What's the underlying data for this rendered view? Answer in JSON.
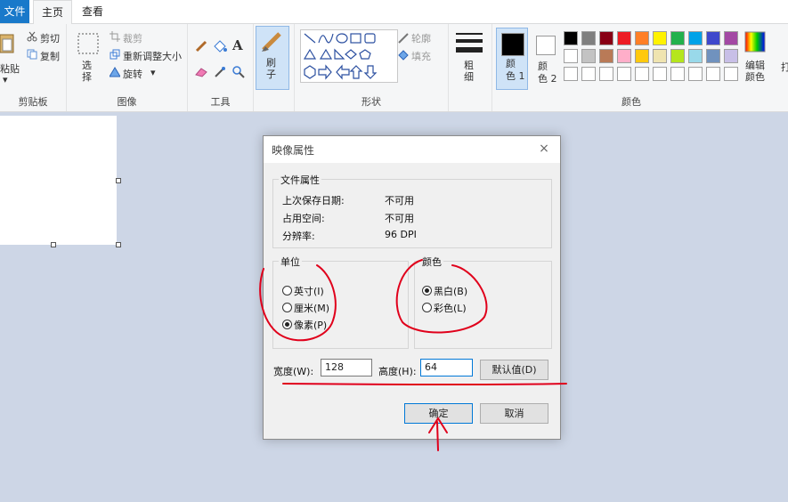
{
  "menubar": {
    "file_tab": "文件",
    "home_tab": "主页",
    "view_tab": "查看"
  },
  "ribbon": {
    "clipboard": {
      "paste": "粘贴",
      "cut": "剪切",
      "copy": "复制",
      "label": "剪贴板"
    },
    "image": {
      "select": "选\n择",
      "crop": "裁剪",
      "resize": "重新调整大小",
      "rotate": "旋转",
      "label": "图像"
    },
    "tools": {
      "label": "工具"
    },
    "brushes": {
      "label": "刷\n子"
    },
    "shapes": {
      "outline": "轮廓",
      "fill": "填充",
      "label": "形状"
    },
    "size": {
      "label": "粗\n细"
    },
    "colors": {
      "color1": "颜\n色 1",
      "color2": "颜\n色 2",
      "edit": "编辑\n颜色",
      "label": "颜色",
      "palette_row1": [
        "#000000",
        "#7f7f7f",
        "#880015",
        "#ed1c24",
        "#ff7f27",
        "#fff200",
        "#22b14c",
        "#00a2e8",
        "#3f48cc",
        "#a349a4"
      ],
      "palette_row2": [
        "#ffffff",
        "#c3c3c3",
        "#b97a57",
        "#ffaec9",
        "#ffc90e",
        "#efe4b0",
        "#b5e61d",
        "#99d9ea",
        "#7092be",
        "#c8bfe7"
      ]
    }
  },
  "dialog": {
    "title": "映像属性",
    "close_glyph": "×",
    "file_props": {
      "legend": "文件属性",
      "rows": [
        {
          "label": "上次保存日期:",
          "value": "不可用"
        },
        {
          "label": "占用空间:",
          "value": "不可用"
        },
        {
          "label": "分辨率:",
          "value": "96 DPI"
        }
      ]
    },
    "units": {
      "legend": "单位",
      "inches": "英寸(I)",
      "cm": "厘米(M)",
      "pixels": "像素(P)",
      "selected": "pixels"
    },
    "color": {
      "legend": "颜色",
      "bw": "黑白(B)",
      "color": "彩色(L)",
      "selected": "bw"
    },
    "width_label": "宽度(W):",
    "width_value": "128",
    "height_label": "高度(H):",
    "height_value": "64",
    "default_button": "默认值(D)",
    "ok_button": "确定",
    "cancel_button": "取消"
  },
  "annotation_color": "#e0001b"
}
